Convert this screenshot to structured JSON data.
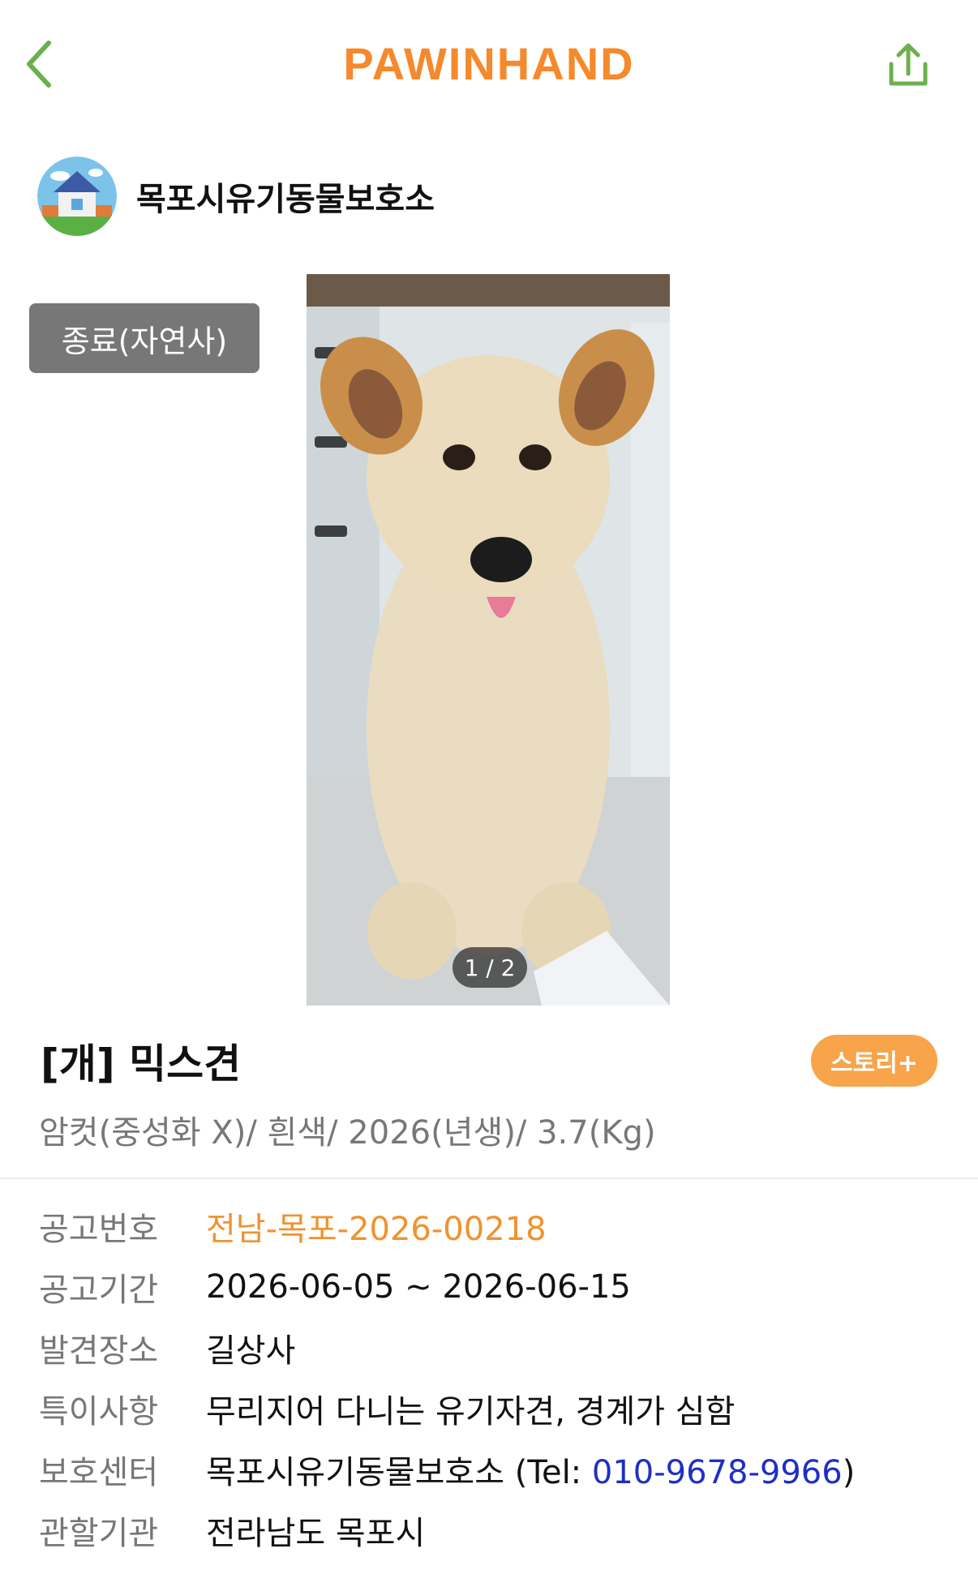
{
  "colors": {
    "accent_green": "#6ab04c",
    "brand_orange": "#f5892b",
    "badge_gray": "#777777",
    "story_orange": "#f7a44a",
    "notice_orange": "#f0922f",
    "phone_blue": "#1f2fc4"
  },
  "header": {
    "back_icon": "chevron-left-icon",
    "logo": "PAWINHAND",
    "share_icon": "share-icon"
  },
  "shelter": {
    "avatar_icon": "house-icon",
    "name": "목포시유기동물보호소"
  },
  "status_badge": "종료(자연사)",
  "photo": {
    "pager": "1 / 2"
  },
  "animal": {
    "title": "[개] 믹스견",
    "story_button": "스토리+",
    "summary": "암컷(중성화 X)/ 흰색/ 2026(년생)/ 3.7(Kg)"
  },
  "info": {
    "notice_no_label": "공고번호",
    "notice_no": "전남-목포-2026-00218",
    "period_label": "공고기간",
    "period": "2026-06-05 ~ 2026-06-15",
    "found_place_label": "발견장소",
    "found_place": "길상사",
    "notes_label": "특이사항",
    "notes": "무리지어 다니는 유기자견, 경계가 심함",
    "center_label": "보호센터",
    "center_name": "목포시유기동물보호소 (Tel: ",
    "center_phone": "010-9678-9966",
    "center_close": ")",
    "authority_label": "관할기관",
    "authority": "전라남도 목포시"
  }
}
